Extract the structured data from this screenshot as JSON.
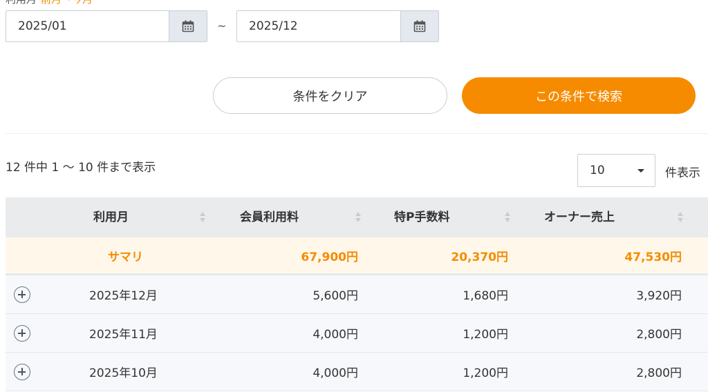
{
  "filter": {
    "label": "利用月",
    "label_accent": "前月〜今月",
    "date_from": "2025/01",
    "date_to": "2025/12",
    "range_separator": "~"
  },
  "buttons": {
    "clear": "条件をクリア",
    "search": "この条件で検索"
  },
  "results": {
    "count_text": "12 件中 1 〜 10 件まで表示",
    "per_page_value": "10",
    "per_page_label": "件表示"
  },
  "table": {
    "headers": [
      "利用月",
      "会員利用料",
      "特P手数料",
      "オーナー売上"
    ],
    "summary": {
      "label": "サマリ",
      "member_fee": "67,900円",
      "commission": "20,370円",
      "owner_sales": "47,530円"
    },
    "rows": [
      {
        "month": "2025年12月",
        "member_fee": "5,600円",
        "commission": "1,680円",
        "owner_sales": "3,920円"
      },
      {
        "month": "2025年11月",
        "member_fee": "4,000円",
        "commission": "1,200円",
        "owner_sales": "2,800円"
      },
      {
        "month": "2025年10月",
        "member_fee": "4,000円",
        "commission": "1,200円",
        "owner_sales": "2,800円"
      }
    ]
  },
  "colors": {
    "accent": "#f68b00",
    "summary_bg": "#fff8ea",
    "header_bg": "#eaebed"
  }
}
